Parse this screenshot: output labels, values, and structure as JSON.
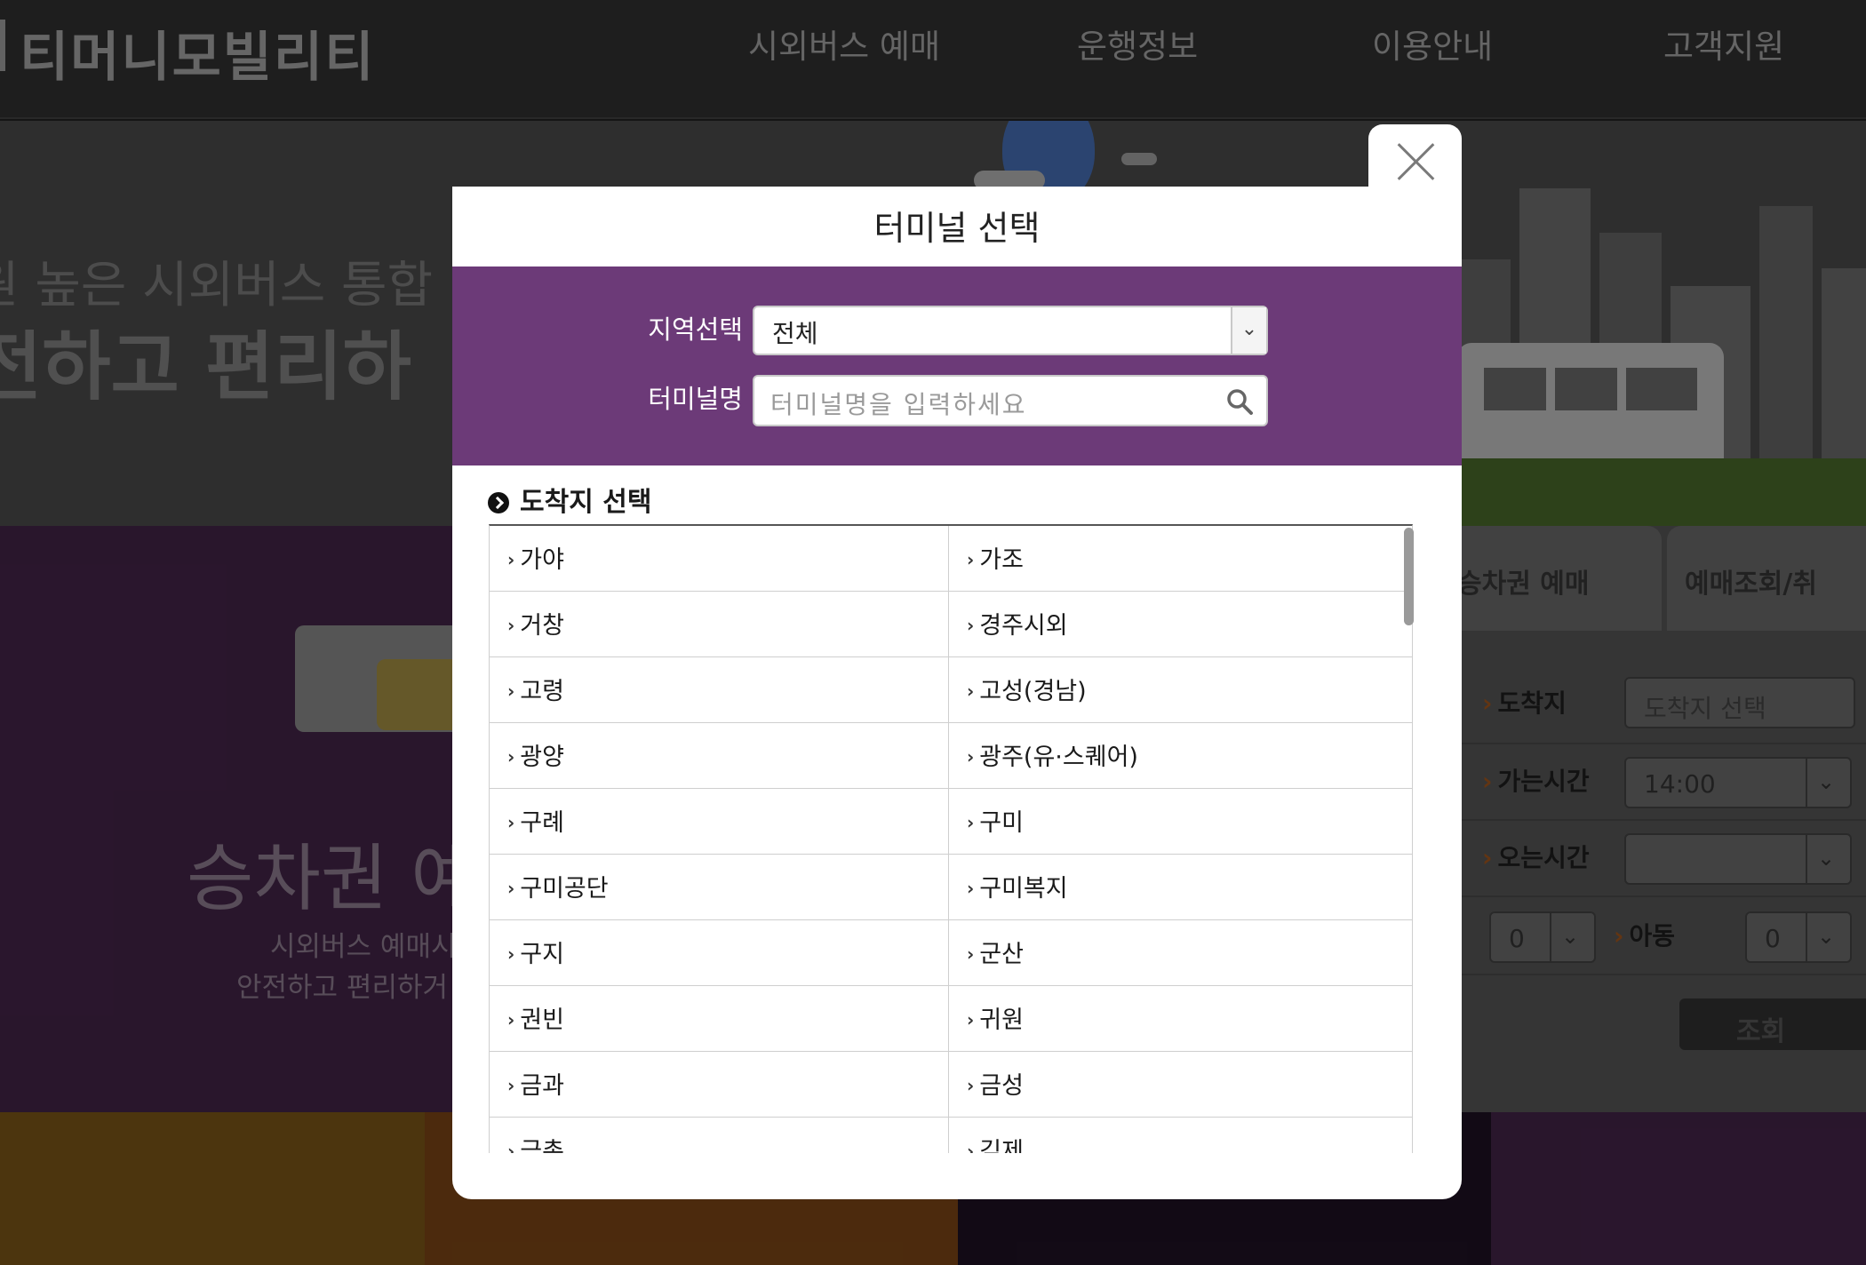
{
  "header": {
    "logo": "티머니모빌리티",
    "nav": [
      "시외버스 예매",
      "운행정보",
      "이용안내",
      "고객지원"
    ]
  },
  "hero": {
    "line1": "원 높은 시외버스 통합",
    "line2": "전하고 편리하"
  },
  "promo": {
    "title": "승차권 예",
    "sub1": "시외버스 예매시",
    "sub2": "안전하고 편리하거"
  },
  "booking": {
    "tab1": "승차권 예매",
    "tab2": "예매조회/취",
    "arrival_label": "도착지",
    "arrival_placeholder": "도착지 선택",
    "go_time_label": "가는시간",
    "go_time_value": "14:00",
    "return_time_label": "오는시간",
    "adult_count": "0",
    "child_label": "아동",
    "child_count": "0",
    "search_label": "조회"
  },
  "modal": {
    "title": "터미널 선택",
    "region_label": "지역선택",
    "region_value": "전체",
    "terminal_label": "터미널명",
    "terminal_placeholder": "터미널명을 입력하세요",
    "section_title": "도착지 선택",
    "terminals": [
      [
        "가야",
        "가조"
      ],
      [
        "거창",
        "경주시외"
      ],
      [
        "고령",
        "고성(경남)"
      ],
      [
        "광양",
        "광주(유·스퀘어)"
      ],
      [
        "구례",
        "구미"
      ],
      [
        "구미공단",
        "구미복지"
      ],
      [
        "구지",
        "군산"
      ],
      [
        "권빈",
        "귀원"
      ],
      [
        "금과",
        "금성"
      ],
      [
        "금촌",
        "김제"
      ]
    ]
  },
  "colors": {
    "modal_accent": "#6c3a78",
    "background_purple": "#3a1f3e"
  }
}
